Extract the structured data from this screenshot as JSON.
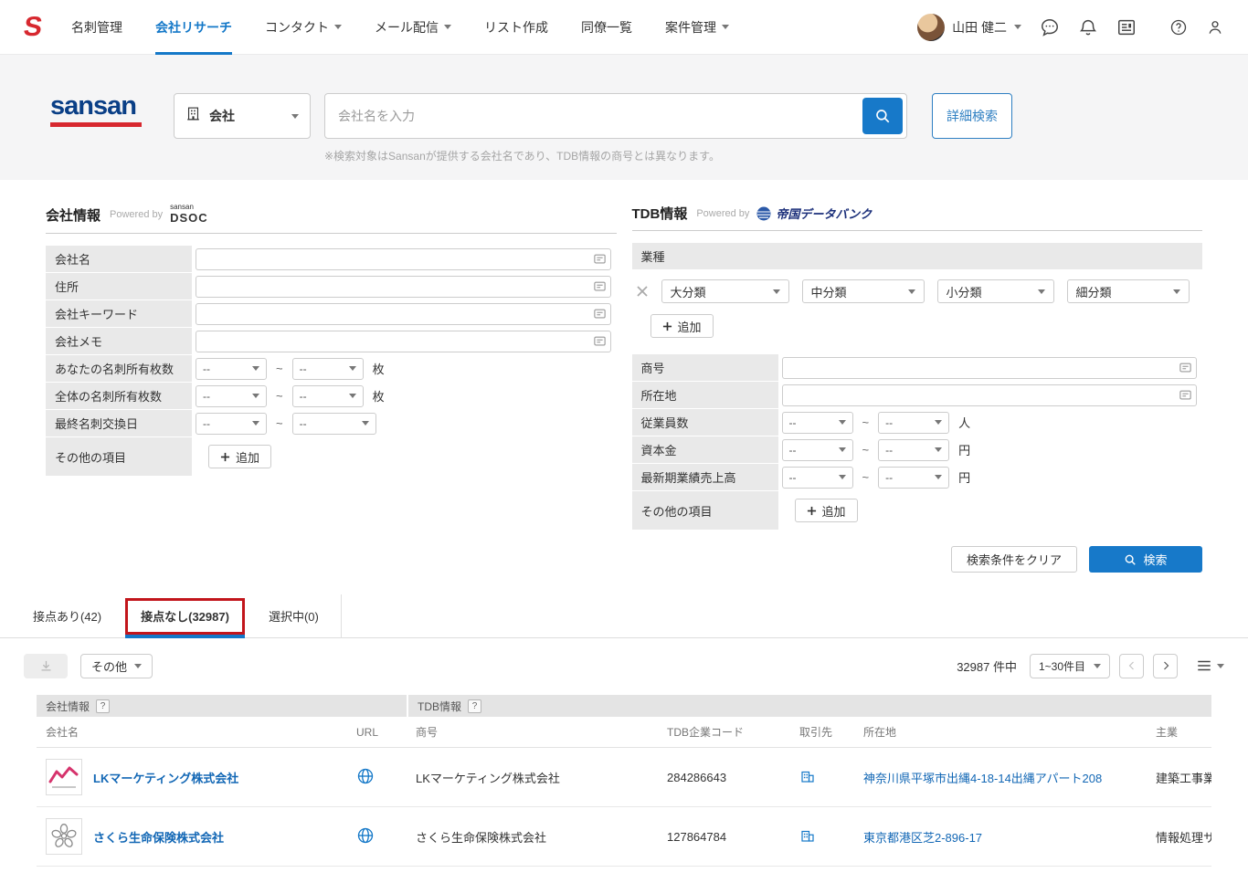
{
  "colors": {
    "primary_blue": "#1478c8",
    "button_blue": "#1779c9",
    "link_blue": "#1267b5",
    "accent_red": "#d7282f",
    "tab_highlight_red": "#c2151b",
    "label_gray": "#e9e9e9"
  },
  "topnav": {
    "logo_letter": "S",
    "nav_items": [
      {
        "label": "名刺管理"
      },
      {
        "label": "会社リサーチ"
      },
      {
        "label": "コンタクト"
      },
      {
        "label": "メール配信"
      },
      {
        "label": "リスト作成"
      },
      {
        "label": "同僚一覧"
      },
      {
        "label": "案件管理"
      }
    ],
    "user_name": "山田 健二"
  },
  "search_bar": {
    "brand": "sansan",
    "category": "会社",
    "placeholder": "会社名を入力",
    "advanced_label": "詳細検索",
    "note": "※検索対象はSansanが提供する会社名であり、TDB情報の商号とは異なります。"
  },
  "sansan_form": {
    "title": "会社情報",
    "powered_by": "Powered by",
    "brand_top": "sansan",
    "brand_bottom": "DSOC",
    "labels": {
      "company_name": "会社名",
      "address": "住所",
      "keyword": "会社キーワード",
      "memo": "会社メモ",
      "your_cards": "あなたの名刺所有枚数",
      "all_cards": "全体の名刺所有枚数",
      "last_exchange": "最終名刺交換日",
      "other": "その他の項目"
    },
    "range_value": "--",
    "tilde": "~",
    "unit_sheets": "枚",
    "add_label": "追加"
  },
  "tdb_form": {
    "title": "TDB情報",
    "powered_by": "Powered by",
    "brand": "帝国データバンク",
    "industry_label": "業種",
    "class_selects": [
      "大分類",
      "中分類",
      "小分類",
      "細分類"
    ],
    "labels": {
      "trade_name": "商号",
      "location": "所在地",
      "employees": "従業員数",
      "capital": "資本金",
      "latest_sales": "最新期業績売上高",
      "other": "その他の項目"
    },
    "range_value": "--",
    "tilde": "~",
    "unit_people": "人",
    "unit_yen": "円",
    "add_label": "追加"
  },
  "form_actions": {
    "clear_label": "検索条件をクリア",
    "search_label": "検索"
  },
  "tabs": [
    {
      "label": "接点あり(42)"
    },
    {
      "label": "接点なし(32987)"
    },
    {
      "label": "選択中(0)"
    }
  ],
  "toolbar": {
    "other_label": "その他",
    "count_label": "32987 件中",
    "page_range": "1~30件目"
  },
  "results_table": {
    "group_headers": [
      "会社情報",
      "TDB情報"
    ],
    "columns": [
      "会社名",
      "URL",
      "商号",
      "TDB企業コード",
      "取引先",
      "所在地",
      "主業"
    ],
    "rows": [
      {
        "company_name": "LKマーケティング株式会社",
        "trade_name": "LKマーケティング株式会社",
        "tdb_code": "284286643",
        "location": "神奈川県平塚市出縄4-18-14出縄アパート208",
        "main_business": "建築工事業（木造"
      },
      {
        "company_name": "さくら生命保険株式会社",
        "trade_name": "さくら生命保険株式会社",
        "tdb_code": "127864784",
        "location": "東京都港区芝2-896-17",
        "main_business": "情報処理サービス"
      }
    ]
  },
  "misc": {
    "question_badge": "?"
  }
}
